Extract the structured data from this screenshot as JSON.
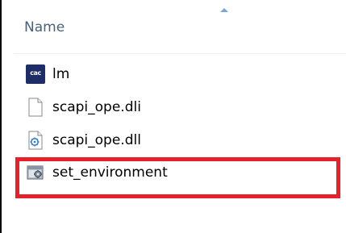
{
  "header": {
    "column_name": "Name"
  },
  "files": [
    {
      "name": "lm",
      "icon": "application-icon",
      "icon_text": "cac"
    },
    {
      "name": "scapi_ope.dli",
      "icon": "blank-file-icon"
    },
    {
      "name": "scapi_ope.dll",
      "icon": "dll-settings-file-icon"
    },
    {
      "name": "set_environment",
      "icon": "batch-file-icon"
    }
  ],
  "highlight": {
    "target": "set_environment",
    "color": "#e8202a"
  }
}
